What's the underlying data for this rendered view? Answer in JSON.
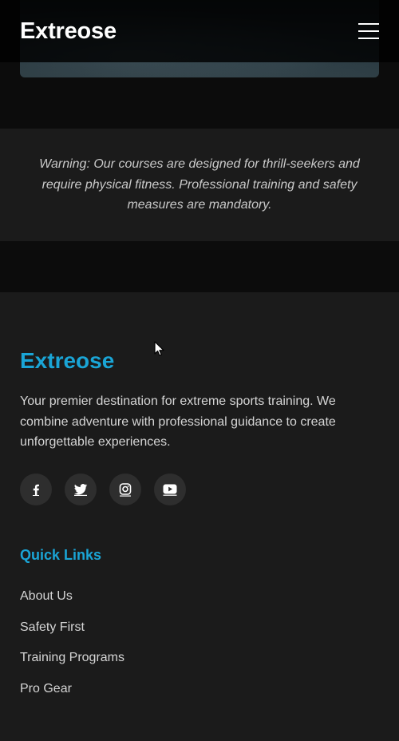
{
  "header": {
    "brand": "Extreose",
    "menu_icon": "hamburger-menu-icon"
  },
  "warning": {
    "text": "Warning: Our courses are designed for thrill-seekers and require physical fitness. Professional training and safety measures are mandatory."
  },
  "footer": {
    "brand": "Extreose",
    "description": "Your premier destination for extreme sports training. We combine adventure with professional guidance to create unforgettable experiences.",
    "socials": [
      {
        "icon": "facebook-icon"
      },
      {
        "icon": "twitter-icon"
      },
      {
        "icon": "instagram-icon"
      },
      {
        "icon": "youtube-icon"
      }
    ],
    "quick_links_title": "Quick Links",
    "quick_links": [
      "About Us",
      "Safety First",
      "Training Programs",
      "Pro Gear"
    ]
  },
  "colors": {
    "accent": "#1aa5d6",
    "background": "#0c0c0c",
    "panel": "#1b1b1b",
    "text": "#d5d5d5"
  }
}
